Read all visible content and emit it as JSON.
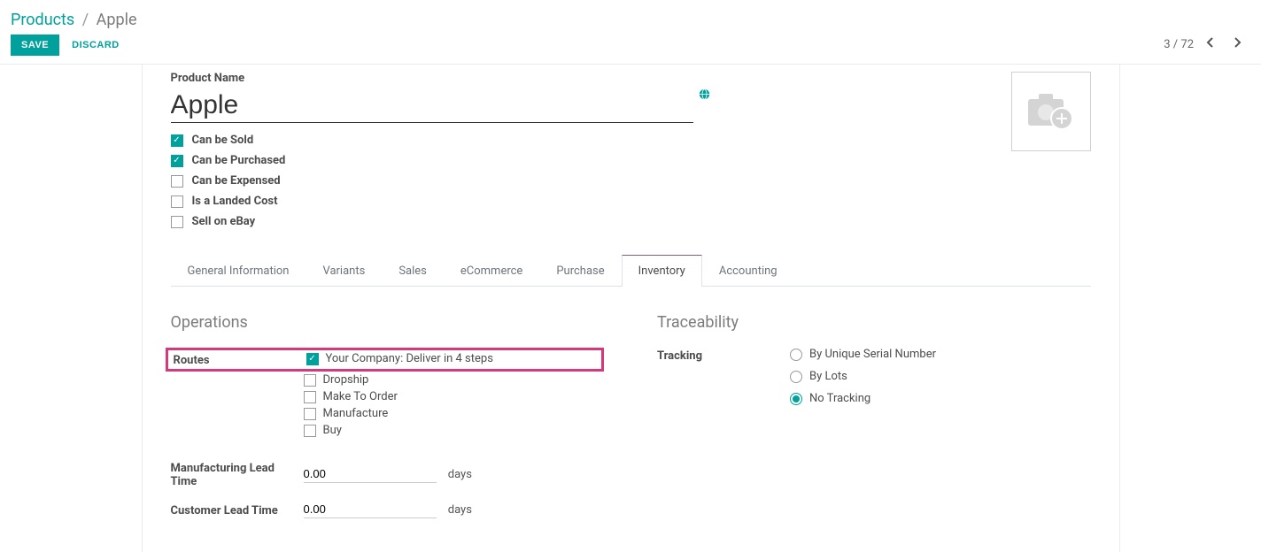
{
  "breadcrumb": {
    "root": "Products",
    "current": "Apple"
  },
  "actions": {
    "save": "SAVE",
    "discard": "DISCARD"
  },
  "pager": {
    "position": "3 / 72"
  },
  "product": {
    "name_label": "Product Name",
    "name": "Apple"
  },
  "options": {
    "can_be_sold": "Can be Sold",
    "can_be_purchased": "Can be Purchased",
    "can_be_expensed": "Can be Expensed",
    "is_landed_cost": "Is a Landed Cost",
    "sell_on_ebay": "Sell on eBay"
  },
  "tabs": {
    "general": "General Information",
    "variants": "Variants",
    "sales": "Sales",
    "ecommerce": "eCommerce",
    "purchase": "Purchase",
    "inventory": "Inventory",
    "accounting": "Accounting"
  },
  "inventory": {
    "operations_title": "Operations",
    "routes_label": "Routes",
    "routes": {
      "deliver": "Your Company: Deliver in 4 steps",
      "dropship": "Dropship",
      "make_to_order": "Make To Order",
      "manufacture": "Manufacture",
      "buy": "Buy"
    },
    "mfg_lead_label": "Manufacturing Lead Time",
    "mfg_lead_value": "0.00",
    "cust_lead_label": "Customer Lead Time",
    "cust_lead_value": "0.00",
    "unit": "days",
    "traceability_title": "Traceability",
    "tracking_label": "Tracking",
    "tracking": {
      "serial": "By Unique Serial Number",
      "lots": "By Lots",
      "none": "No Tracking"
    }
  }
}
